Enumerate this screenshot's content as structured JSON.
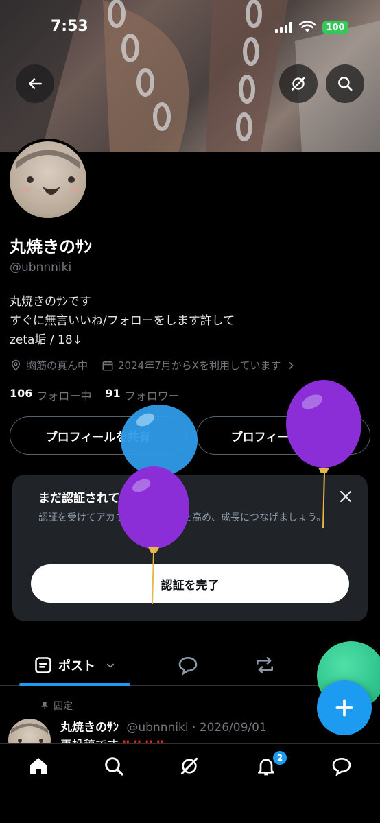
{
  "status": {
    "time": "7:53",
    "battery": "100"
  },
  "profile": {
    "name": "丸焼きのｻﾝ",
    "handle": "@ubnnniki",
    "bio": [
      "丸焼きのｻﾝです",
      "すぐに無言いいね/フォローをします許して",
      "zeta垢 / 18↓"
    ],
    "location": "胸筋の真ん中",
    "joined": "2024年7月からXを利用しています",
    "following_count": "106",
    "following_label": "フォロー中",
    "followers_count": "91",
    "followers_label": "フォロワー"
  },
  "buttons": {
    "share": "プロフィールを共有",
    "edit": "プロフィールを編集"
  },
  "verify": {
    "title": "まだ認証されていません",
    "description": "認証を受けてアカウントの信用度を高め、成長につなげましょう。",
    "button": "認証を完了"
  },
  "tabs": {
    "active": "ポスト"
  },
  "post": {
    "pinned": "固定",
    "name": "丸焼きのｻﾝ",
    "meta": "@ubnnniki · 2026/09/01",
    "text": "再投稿です"
  },
  "nav": {
    "notification_badge": "2"
  },
  "colors": {
    "accent": "#1d9bf0",
    "background": "#000000",
    "card": "#202327"
  },
  "icons": [
    "back-arrow-icon",
    "grok-icon",
    "search-icon",
    "location-icon",
    "calendar-icon",
    "close-icon",
    "posts-icon",
    "reply-icon",
    "repost-icon",
    "video-icon",
    "pin-icon",
    "plus-icon",
    "home-icon",
    "bell-icon",
    "message-icon"
  ]
}
